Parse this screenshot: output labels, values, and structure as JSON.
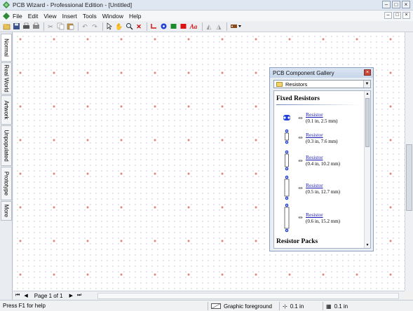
{
  "window": {
    "title": "PCB Wizard - Professional Edition - [Untitled]",
    "controls": {
      "minimize": "–",
      "maximize": "□",
      "close": "×"
    }
  },
  "menubar": {
    "items": [
      "File",
      "Edit",
      "View",
      "Insert",
      "Tools",
      "Window",
      "Help"
    ],
    "doc_controls": {
      "minimize": "–",
      "restore": "□",
      "close": "×"
    }
  },
  "toolbar": {
    "icons": [
      "new-icon",
      "open-icon",
      "save-icon",
      "print-icon",
      "cut-icon",
      "copy-icon",
      "paste-icon",
      "undo-icon",
      "redo-icon",
      "pointer-icon",
      "hand-icon",
      "zoom-icon",
      "delete-icon",
      "track-icon",
      "pad-icon",
      "rectangle-green-icon",
      "rectangle-red-icon",
      "text-icon",
      "mirror-icon",
      "rotate-icon",
      "component-dropdown-icon"
    ],
    "text_tool_label": "Aa"
  },
  "left_tabs": [
    "Normal",
    "Real World",
    "Artwork",
    "Unpopulated",
    "Prototype",
    "More"
  ],
  "page_nav": {
    "label": "Page 1 of 1"
  },
  "statusbar": {
    "help": "Press F1 for help",
    "layer": "Graphic foreground",
    "grid1": "0.1 in",
    "grid2": "0.1 in"
  },
  "gallery": {
    "title": "PCB Component Gallery",
    "close": "×",
    "category": "Resistors",
    "section1": "Fixed Resistors",
    "section2": "Resistor Packs",
    "items": [
      {
        "label": "Resistor",
        "desc": "(0.1 in, 2.5 mm)"
      },
      {
        "label": "Resistor",
        "desc": "(0.3 in, 7.6 mm)"
      },
      {
        "label": "Resistor",
        "desc": "(0.4 in, 10.2 mm)"
      },
      {
        "label": "Resistor",
        "desc": "(0.5 in, 12.7 mm)"
      },
      {
        "label": "Resistor",
        "desc": "(0.6 in, 15.2 mm)"
      }
    ]
  },
  "colors": {
    "accent": "#1a1ab4",
    "pad_blue": "#1f3fd6",
    "grid_red": "#e05050"
  }
}
